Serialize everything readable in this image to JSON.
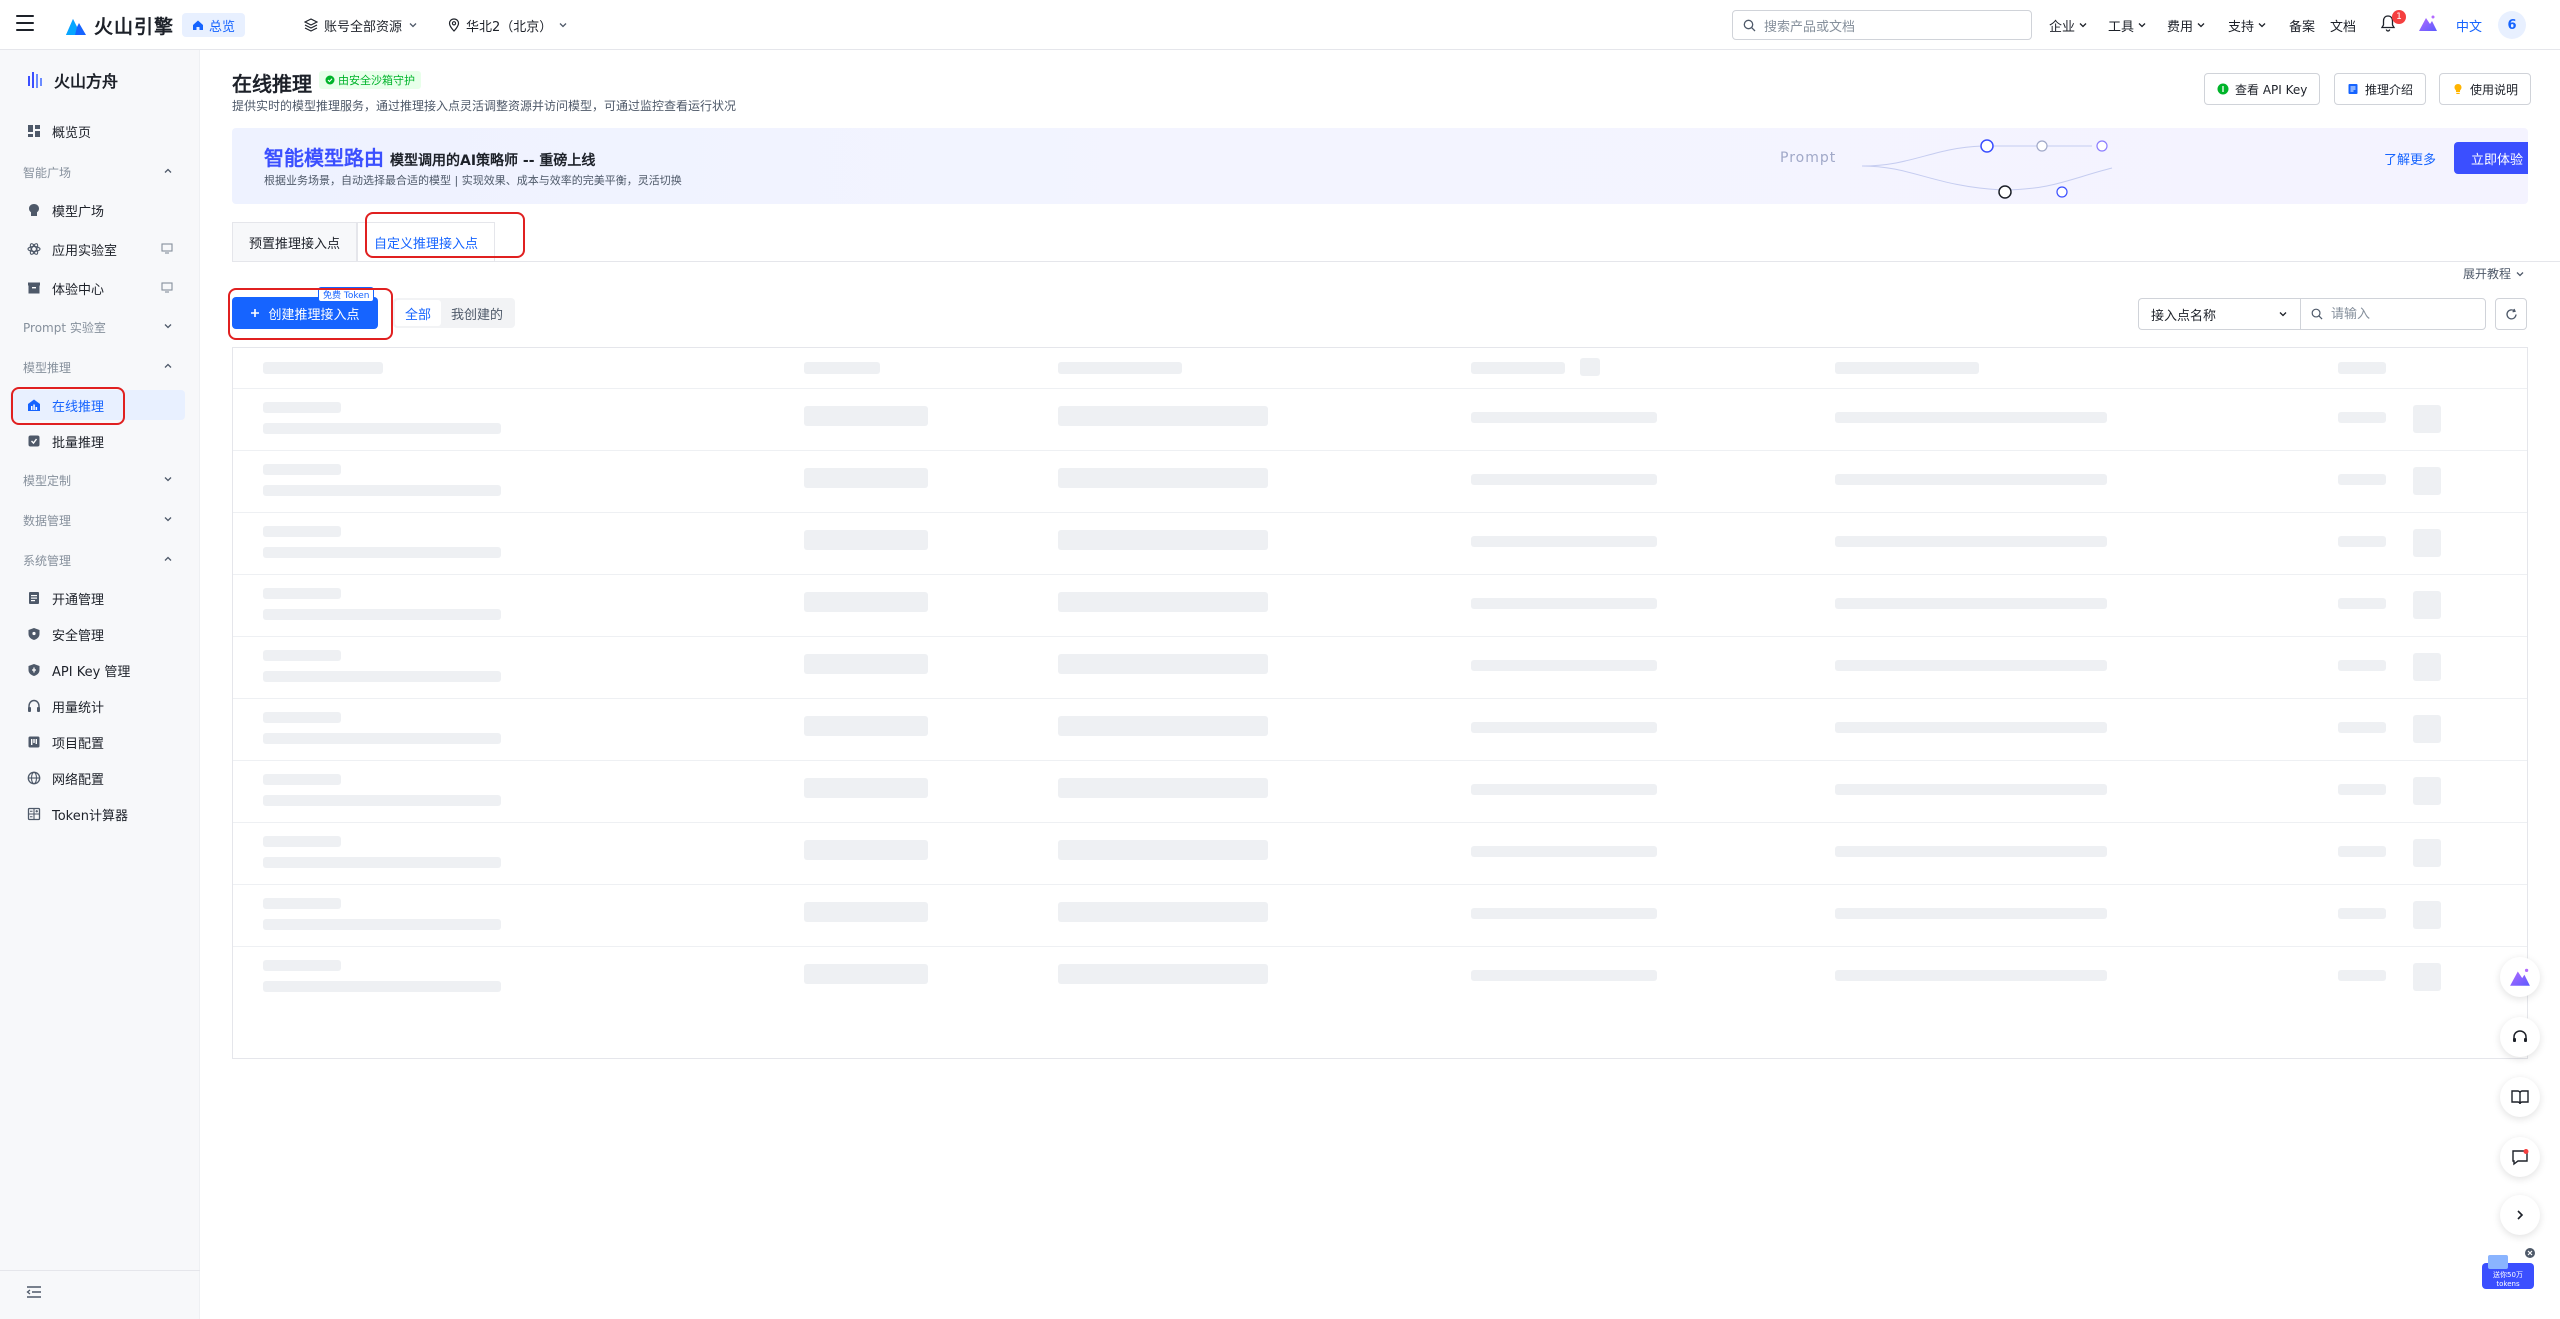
{
  "topbar": {
    "brand": "火山引擎",
    "home": "总览",
    "account_scope": "账号全部资源",
    "region": "华北2（北京）",
    "search_placeholder": "搜索产品或文档",
    "nav": [
      "企业",
      "工具",
      "费用",
      "支持"
    ],
    "links": [
      "备案",
      "文档"
    ],
    "notification_count": "1",
    "language": "中文",
    "user_initial": "6"
  },
  "sidebar": {
    "brand": "火山方舟",
    "overview": "概览页",
    "groups": {
      "model_square": "智能广场",
      "prompt_lab": "Prompt 实验室",
      "model_inference": "模型推理",
      "model_custom": "模型定制",
      "data_mgmt": "数据管理",
      "system_mgmt": "系统管理"
    },
    "items": {
      "model_plaza": "模型广场",
      "app_lab": "应用实验室",
      "experience_center": "体验中心",
      "online_inference": "在线推理",
      "batch_inference": "批量推理",
      "activation": "开通管理",
      "security": "安全管理",
      "api_key": "API Key 管理",
      "usage": "用量统计",
      "project": "项目配置",
      "network": "网络配置",
      "token_calc": "Token计算器"
    }
  },
  "page": {
    "title": "在线推理",
    "secure_badge": "由安全沙箱守护",
    "description": "提供实时的模型推理服务，通过推理接入点灵活调整资源并访问模型，可通过监控查看运行状况",
    "buttons": {
      "api_key": "查看 API Key",
      "intro": "推理介绍",
      "guide": "使用说明"
    }
  },
  "banner": {
    "highlight": "智能模型路由",
    "title_rest": "模型调用的AI策略师 -- 重磅上线",
    "subtitle": "根据业务场景，自动选择最合适的模型 | 实现效果、成本与效率的完美平衡，灵活切换",
    "decor_text": "Prompt",
    "learn_more": "了解更多",
    "cta": "立即体验"
  },
  "tabs": [
    "预置推理接入点",
    "自定义推理接入点"
  ],
  "active_tab": 1,
  "toolbar": {
    "expand_tutorial": "展开教程",
    "create_button": "创建推理接入点",
    "free_badge": "免费 Token",
    "segments": [
      "全部",
      "我创建的"
    ],
    "filter_field": "接入点名称",
    "filter_placeholder": "请输入"
  },
  "table": {
    "state": "loading",
    "skeleton_rows": 10
  },
  "promo_widget": "送你50万tokens",
  "colors": {
    "primary": "#1664ff",
    "banner_accent": "#3b4fff",
    "annotation": "#e02020"
  }
}
